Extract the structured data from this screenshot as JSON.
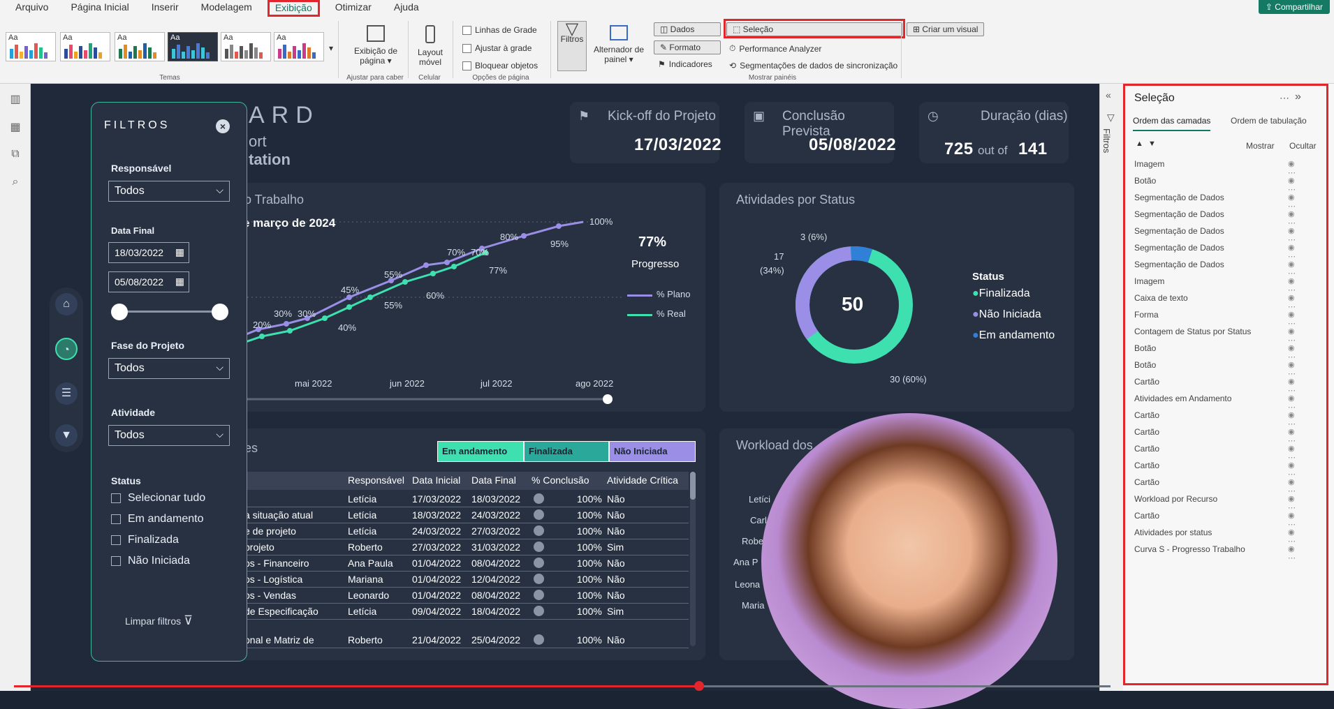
{
  "ribbon": {
    "menu": [
      "Arquivo",
      "Página Inicial",
      "Inserir",
      "Modelagem",
      "Exibição",
      "Otimizar",
      "Ajuda"
    ],
    "active_menu": "Exibição",
    "share_label": "Compartilhar",
    "group_themes": "Temas",
    "fit_page_label": "Exibição de página",
    "fit_group": "Ajustar para caber",
    "mobile_label": "Layout móvel",
    "mobile_group": "Celular",
    "gridlines_label": "Linhas de Grade",
    "snap_label": "Ajustar à grade",
    "lock_label": "Bloquear objetos",
    "page_options_group": "Opções de página",
    "filters_label": "Filtros",
    "switch_panel_label": "Alternador de painel",
    "data_label": "Dados",
    "format_label": "Formato",
    "bookmarks_label": "Indicadores",
    "selection_label": "Seleção",
    "perf_label": "Performance Analyzer",
    "sync_label": "Segmentações de dados de sincronização",
    "show_panes_group": "Mostrar painéis",
    "create_visual_label": "Criar um visual"
  },
  "dashboard": {
    "title_part": "ARD",
    "subtitle1": "ort",
    "subtitle2": "tation",
    "kpi1": {
      "title": "Kick-off do Projeto",
      "value": "17/03/2022"
    },
    "kpi2": {
      "title": "Conclusão Prevista",
      "value": "05/08/2022"
    },
    "kpi3": {
      "title": "Duração (dias)",
      "value": "725",
      "out_of": "out of",
      "total": "141"
    },
    "curve_title": "o Trabalho",
    "curve_date": "e março de 2024",
    "progress_value": "77%",
    "progress_label": "Progresso",
    "legend_plan": "% Plano",
    "legend_real": "% Real",
    "status_title": "Atividades por Status",
    "donut_center": "50",
    "donut_label_top": "3 (6%)",
    "donut_label_left1": "17",
    "donut_label_left2": "(34%)",
    "donut_label_bottom": "30 (60%)",
    "status_legend_title": "Status",
    "status_legend": [
      "Finalizada",
      "Não Iniciada",
      "Em andamento"
    ],
    "table_title": "es",
    "table_tabs": [
      "Em andamento",
      "Finalizada",
      "Não Iniciada"
    ],
    "workload_title": "Workload dos",
    "workload_names": [
      "Letíci",
      "Carl",
      "Robe",
      "Ana P",
      "Leona",
      "Maria"
    ]
  },
  "chart_data": {
    "type": "line",
    "x": [
      "mai 2022",
      "jun 2022",
      "jul 2022",
      "ago 2022"
    ],
    "series": [
      {
        "name": "% Plano",
        "labels": [
          "20%",
          "30%",
          "30%",
          "45%",
          "55%",
          "70%",
          "70%",
          "80%",
          "95%",
          "100%"
        ]
      },
      {
        "name": "% Real",
        "labels": [
          "40%",
          "55%",
          "60%",
          "77%"
        ]
      }
    ],
    "xlabel": "",
    "ylabel": ""
  },
  "table": {
    "headers": [
      "Responsável",
      "Data Inicial",
      "Data Final",
      "% Conclusão",
      "Atividade Crítica"
    ],
    "rows": [
      {
        "task": "",
        "resp": "Letícia",
        "start": "17/03/2022",
        "end": "18/03/2022",
        "pct": "100%",
        "crit": "Não"
      },
      {
        "task": "a situação atual",
        "resp": "Letícia",
        "start": "18/03/2022",
        "end": "24/03/2022",
        "pct": "100%",
        "crit": "Não"
      },
      {
        "task": "e de projeto",
        "resp": "Letícia",
        "start": "24/03/2022",
        "end": "27/03/2022",
        "pct": "100%",
        "crit": "Não"
      },
      {
        "task": "projeto",
        "resp": "Roberto",
        "start": "27/03/2022",
        "end": "31/03/2022",
        "pct": "100%",
        "crit": "Sim"
      },
      {
        "task": "os - Financeiro",
        "resp": "Ana Paula",
        "start": "01/04/2022",
        "end": "08/04/2022",
        "pct": "100%",
        "crit": "Não"
      },
      {
        "task": "os - Logística",
        "resp": "Mariana",
        "start": "01/04/2022",
        "end": "12/04/2022",
        "pct": "100%",
        "crit": "Não"
      },
      {
        "task": "os - Vendas",
        "resp": "Leonardo",
        "start": "01/04/2022",
        "end": "08/04/2022",
        "pct": "100%",
        "crit": "Não"
      },
      {
        "task": "de Especificação",
        "resp": "Letícia",
        "start": "09/04/2022",
        "end": "18/04/2022",
        "pct": "100%",
        "crit": "Sim"
      },
      {
        "task": "onal e Matriz de",
        "resp": "Roberto",
        "start": "21/04/2022",
        "end": "25/04/2022",
        "pct": "100%",
        "crit": "Não"
      }
    ]
  },
  "filters": {
    "title": "FILTROS",
    "responsavel_label": "Responsável",
    "responsavel_value": "Todos",
    "data_final_label": "Data Final",
    "date_from": "18/03/2022",
    "date_to": "05/08/2022",
    "fase_label": "Fase do Projeto",
    "fase_value": "Todos",
    "atividade_label": "Atividade",
    "atividade_value": "Todos",
    "status_label": "Status",
    "status_options": [
      "Selecionar tudo",
      "Em andamento",
      "Finalizada",
      "Não Iniciada"
    ],
    "clear_label": "Limpar filtros"
  },
  "selection_pane": {
    "title": "Seleção",
    "tab_layers": "Ordem das camadas",
    "tab_order": "Ordem de tabulação",
    "show_label": "Mostrar",
    "hide_label": "Ocultar",
    "side_filters_label": "Filtros",
    "layers": [
      "Imagem",
      "Botão",
      "Segmentação de Dados",
      "Segmentação de Dados",
      "Segmentação de Dados",
      "Segmentação de Dados",
      "Segmentação de Dados",
      "Imagem",
      "Caixa de texto",
      "Forma",
      "Contagem de Status por Status",
      "Botão",
      "Botão",
      "Cartão",
      "Atividades em Andamento",
      "Cartão",
      "Cartão",
      "Cartão",
      "Cartão",
      "Cartão",
      "Workload por Recurso",
      "Cartão",
      "Atividades por status",
      "Curva S - Progresso Trabalho"
    ]
  },
  "colors": {
    "accent_green": "#3ee0b0",
    "plan_purple": "#9a8ee6",
    "status_blue": "#2f80d6",
    "highlight_red": "#e3262b",
    "tab_green": "#3ee0b0",
    "tab_teal": "#2aa89a",
    "tab_purple": "#9a8ee6"
  }
}
